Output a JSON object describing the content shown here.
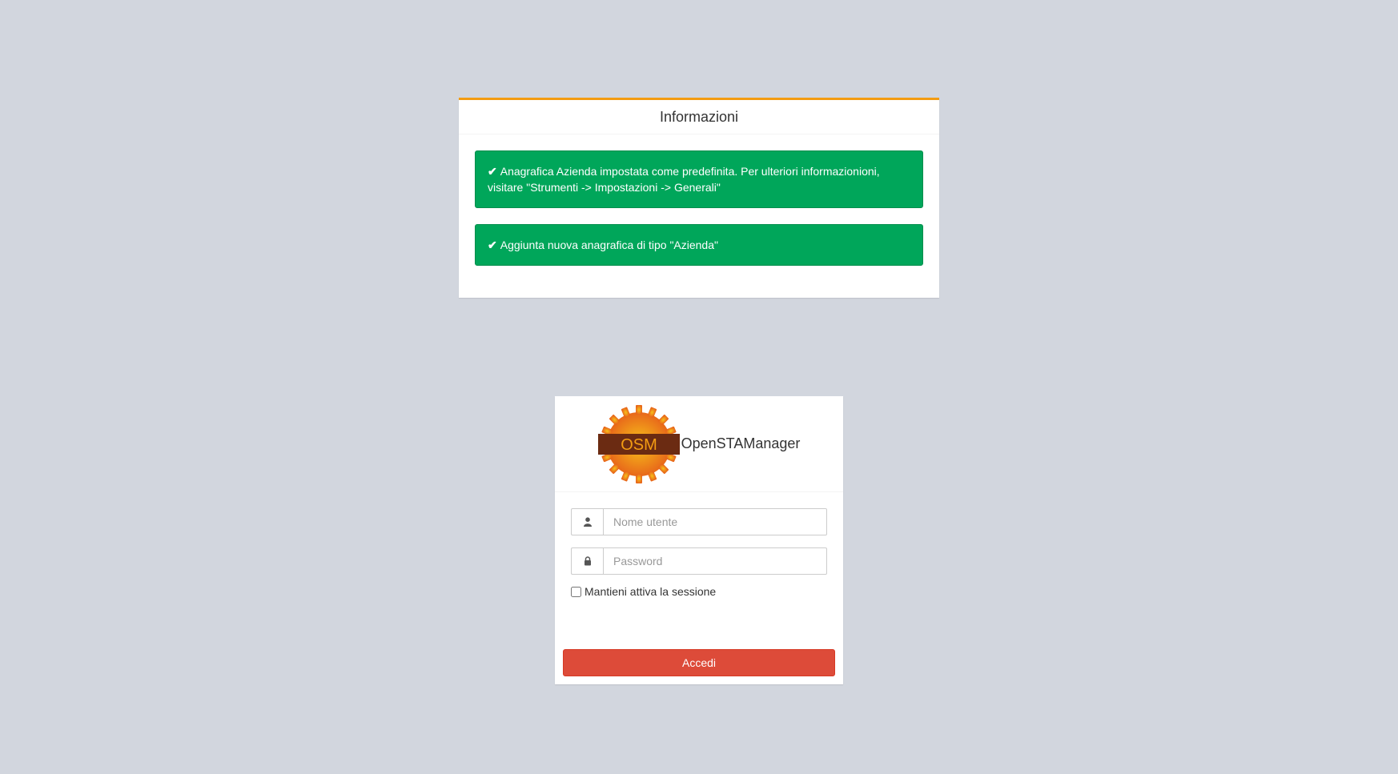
{
  "info": {
    "title": "Informazioni",
    "alerts": [
      {
        "icon": "check-icon",
        "text": "Anagrafica Azienda impostata come predefinita. Per ulteriori informazionioni, visitare \"Strumenti -> Impostazioni -> Generali\""
      },
      {
        "icon": "check-icon",
        "text": "Aggiunta nuova anagrafica di tipo \"Azienda\""
      }
    ]
  },
  "login": {
    "logo_text": "OSM",
    "brand": "OpenSTAManager",
    "username_placeholder": "Nome utente",
    "password_placeholder": "Password",
    "remember_label": "Mantieni attiva la sessione",
    "submit_label": "Accedi"
  },
  "colors": {
    "background": "#d2d6de",
    "info_border": "#f39c12",
    "alert_success": "#00a65a",
    "login_button": "#dd4b39"
  }
}
